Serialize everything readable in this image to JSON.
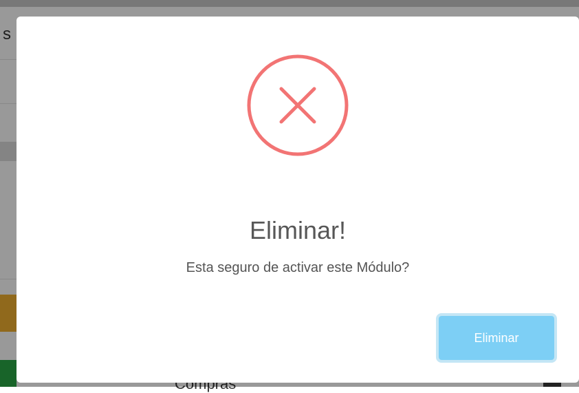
{
  "background": {
    "heading_partial": "s",
    "footer_partial": "Compras"
  },
  "dialog": {
    "icon": "error-x-icon",
    "title": "Eliminar!",
    "message": "Esta seguro de activar este Módulo?",
    "confirm_label": "Eliminar",
    "colors": {
      "icon": "#f27474",
      "button": "#7dcff5",
      "button_ring": "#c4e6f5",
      "title": "#575757"
    }
  }
}
